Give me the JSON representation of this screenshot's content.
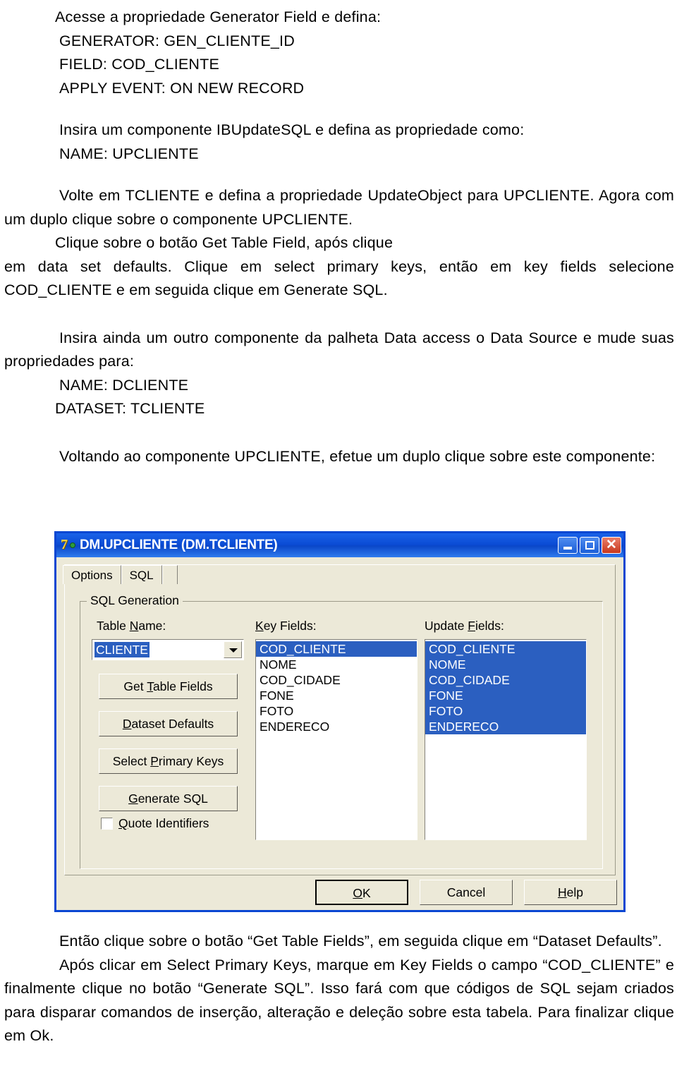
{
  "document": {
    "blocks": [
      {
        "id": "b1",
        "text": "Acesse a propriedade Generator Field e defina:"
      },
      {
        "id": "b2",
        "text": "GENERATOR: GEN_CLIENTE_ID"
      },
      {
        "id": "b3",
        "text": "FIELD: COD_CLIENTE"
      },
      {
        "id": "b4",
        "text": "APPLY EVENT: ON NEW RECORD"
      },
      {
        "id": "b5",
        "text": "Insira um componente IBUpdateSQL e defina as propriedade como:"
      },
      {
        "id": "b6",
        "text": "NAME: UPCLIENTE"
      },
      {
        "id": "b7",
        "text": "Volte em TCLIENTE e defina a propriedade UpdateObject para UPCLIENTE. Agora com um duplo clique sobre o componente UPCLIENTE."
      },
      {
        "id": "b8",
        "text": "Clique sobre o botão Get Table Field, após clique"
      },
      {
        "id": "b9",
        "text": "em data set defaults. Clique em select primary keys, então em key fields selecione COD_CLIENTE e em seguida clique em Generate SQL."
      },
      {
        "id": "b10",
        "text": "Insira ainda um outro componente da palheta Data access o Data Source e mude suas propriedades para:"
      },
      {
        "id": "b11",
        "text": "NAME: DCLIENTE"
      },
      {
        "id": "b12",
        "text": "DATASET: TCLIENTE"
      },
      {
        "id": "b13",
        "text": "Voltando ao componente UPCLIENTE,  efetue um duplo clique sobre este componente:"
      },
      {
        "id": "b14",
        "text": "Então clique sobre o botão “Get Table Fields”, em seguida clique em “Dataset Defaults”."
      },
      {
        "id": "b15",
        "text": "Após clicar em Select Primary Keys, marque em Key Fields o campo “COD_CLIENTE” e finalmente clique no botão “Generate SQL”. Isso fará com que códigos de SQL sejam criados para disparar comandos de inserção, alteração e deleção sobre esta tabela. Para finalizar clique em Ok."
      }
    ]
  },
  "dialog": {
    "title": "DM.UPCLIENTE (DM.TCLIENTE)",
    "titlebar_color": "#0A4BD4",
    "background_color": "#ECE9D8",
    "selection_color": "#2B5FC0",
    "window_buttons": {
      "minimize": "minimize-icon",
      "maximize": "maximize-icon",
      "close": "close-icon"
    },
    "tabs": [
      {
        "label": "Options",
        "active": true
      },
      {
        "label": "SQL",
        "active": false
      }
    ],
    "group_title": "SQL Generation",
    "table_name": {
      "label": "Table Name:",
      "label_pre": "Table ",
      "label_accel": "N",
      "label_post": "ame:",
      "value": "CLIENTE"
    },
    "buttons": [
      {
        "pre": "Get ",
        "accel": "T",
        "post": "able Fields",
        "label": "Get Table Fields"
      },
      {
        "pre": "",
        "accel": "D",
        "post": "ataset Defaults",
        "label": "Dataset Defaults"
      },
      {
        "pre": "Select ",
        "accel": "P",
        "post": "rimary Keys",
        "label": "Select Primary Keys"
      },
      {
        "pre": "",
        "accel": "G",
        "post": "enerate SQL",
        "label": "Generate SQL"
      }
    ],
    "quote_identifiers": {
      "pre": "",
      "accel": "Q",
      "post": "uote Identifiers",
      "label": "Quote Identifiers",
      "checked": false
    },
    "key_fields": {
      "label": "Key Fields:",
      "label_accel": "K",
      "label_post": "ey Fields:",
      "items": [
        {
          "text": "COD_CLIENTE",
          "selected": true
        },
        {
          "text": "NOME",
          "selected": false
        },
        {
          "text": "COD_CIDADE",
          "selected": false
        },
        {
          "text": "FONE",
          "selected": false
        },
        {
          "text": "FOTO",
          "selected": false
        },
        {
          "text": "ENDERECO",
          "selected": false
        }
      ]
    },
    "update_fields": {
      "label": "Update Fields:",
      "label_pre": "Update ",
      "label_accel": "F",
      "label_post": "ields:",
      "items": [
        {
          "text": "COD_CLIENTE",
          "selected": true
        },
        {
          "text": "NOME",
          "selected": true
        },
        {
          "text": "COD_CIDADE",
          "selected": true
        },
        {
          "text": "FONE",
          "selected": true
        },
        {
          "text": "FOTO",
          "selected": true
        },
        {
          "text": "ENDERECO",
          "selected": true
        }
      ]
    },
    "footer": [
      {
        "pre": "",
        "accel": "O",
        "post": "K",
        "label": "OK",
        "default": true
      },
      {
        "pre": "Cancel",
        "accel": "",
        "post": "",
        "label": "Cancel",
        "default": false
      },
      {
        "pre": "",
        "accel": "H",
        "post": "elp",
        "label": "Help",
        "default": false
      }
    ]
  }
}
